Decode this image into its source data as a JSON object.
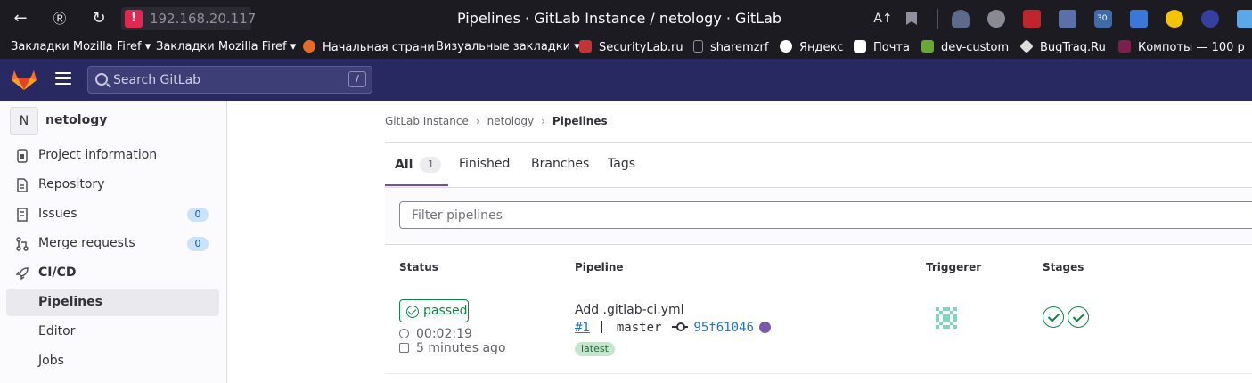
{
  "browser": {
    "url": "192.168.20.117",
    "window_title": "Pipelines · GitLab Instance / netology · GitLab",
    "bookmarks": [
      {
        "label": "Закладки Mozilla Firef",
        "icon": "folder-icon",
        "dropdown": "▾"
      },
      {
        "label": "Закладки Mozilla Firef",
        "icon": "folder-icon",
        "dropdown": "▾"
      },
      {
        "label": "Начальная страни",
        "icon": "firefox-icon"
      },
      {
        "label": "Визуальные закладки",
        "icon": "folder-icon",
        "dropdown": "▾"
      },
      {
        "label": "SecurityLab.ru",
        "icon": "securitylab-icon"
      },
      {
        "label": "sharemzrf",
        "icon": "page-icon"
      },
      {
        "label": "Яндекс",
        "icon": "yandex-icon"
      },
      {
        "label": "Почта",
        "icon": "mail-icon"
      },
      {
        "label": "dev-custom",
        "icon": "dev-icon"
      },
      {
        "label": "BugTraq.Ru",
        "icon": "bugtraq-icon"
      },
      {
        "label": "Компоты — 100 р",
        "icon": "ai-icon"
      }
    ],
    "extension_badge": "30"
  },
  "gitlab_nav": {
    "search_placeholder": "Search GitLab",
    "search_shortcut": "/"
  },
  "sidebar": {
    "project_initial": "N",
    "project_name": "netology",
    "items": [
      {
        "label": "Project information",
        "icon": "info-icon"
      },
      {
        "label": "Repository",
        "icon": "doc-icon"
      },
      {
        "label": "Issues",
        "icon": "issues-icon",
        "badge": "0"
      },
      {
        "label": "Merge requests",
        "icon": "merge-icon",
        "badge": "0"
      },
      {
        "label": "CI/CD",
        "icon": "rocket-icon"
      },
      {
        "label": "Pipelines",
        "active": true
      },
      {
        "label": "Editor"
      },
      {
        "label": "Jobs"
      }
    ]
  },
  "breadcrumb": [
    "GitLab Instance",
    "netology",
    "Pipelines"
  ],
  "tabs": [
    {
      "label": "All",
      "count": "1",
      "active": true
    },
    {
      "label": "Finished"
    },
    {
      "label": "Branches"
    },
    {
      "label": "Tags"
    }
  ],
  "filter_placeholder": "Filter pipelines",
  "table": {
    "headers": [
      "Status",
      "Pipeline",
      "Triggerer",
      "Stages"
    ],
    "rows": [
      {
        "status": "passed",
        "duration": "00:02:19",
        "finished": "5 minutes ago",
        "commit_title": "Add .gitlab-ci.yml",
        "pipeline_id": "#1",
        "branch": "master",
        "sha": "95f61046",
        "tag": "latest",
        "stages": [
          "passed",
          "passed"
        ]
      }
    ]
  },
  "colors": {
    "nav_bg": "#292961",
    "active_tab": "#6e49cb",
    "success": "#108548",
    "link": "#1f75cb"
  }
}
